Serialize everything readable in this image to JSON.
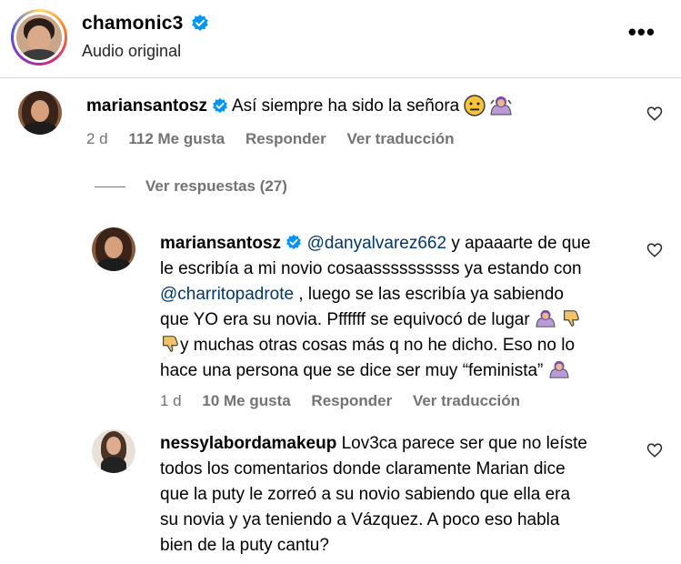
{
  "header": {
    "username": "chamonic3",
    "audio_label": "Audio original",
    "more_label": "•••"
  },
  "comments": [
    {
      "username": "mariansantosz",
      "text": "Así siempre ha sido la señora",
      "time": "2 d",
      "likes": "112 Me gusta",
      "reply": "Responder",
      "translate": "Ver traducción"
    }
  ],
  "view_replies": "Ver respuestas (27)",
  "replies": [
    {
      "username": "mariansantosz",
      "mention1": "@danyalvarez662",
      "line1_rest": " y apaaarte de que",
      "line2": "le escribía a mi novio cosaassssssssss ya estando con",
      "mention2": "@charritopadrote",
      "line3_rest": " , luego se las escribía ya sabiendo",
      "line4": "que YO era su novia. Pffffff se equivocó de lugar",
      "line5": "y muchas otras cosas más q no he dicho. Eso no lo",
      "line6": "hace una persona que se dice ser muy “feminista”",
      "time": "1 d",
      "likes": "10 Me gusta",
      "reply": "Responder",
      "translate": "Ver traducción"
    },
    {
      "username": "nessylabordamakeup",
      "line1": " Lov3ca parece ser que no leíste",
      "line2": "todos los comentarios donde claramente Marian dice",
      "line3": "que la puty le zorreó a su novio sabiendo que ella era",
      "line4": "su novia y ya teniendo a Vázquez. A poco eso habla",
      "line5": "bien de la puty cantu?"
    }
  ],
  "icons": {
    "verified": "verified-badge-icon",
    "heart": "heart-outline-icon",
    "neutral_face": "neutral-face-emoji-icon",
    "shrug": "woman-shrugging-emoji-icon",
    "thumbs_down": "thumbs-down-emoji-icon"
  },
  "colors": {
    "verified_blue": "#0095f6",
    "muted": "#737373",
    "mention": "#00376b"
  }
}
